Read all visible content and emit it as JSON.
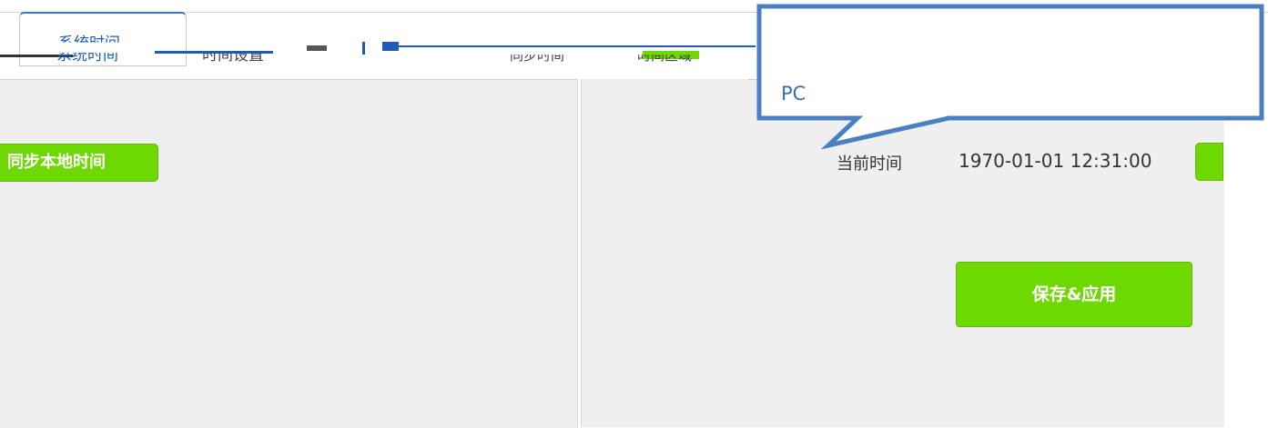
{
  "tabs": [
    {
      "label": "系统时间",
      "active": true
    },
    {
      "label": "时间设置",
      "active": false
    }
  ],
  "glitch_texts": [
    "时间设置",
    "同步时间",
    "时间区域"
  ],
  "left_panel": {
    "sync_button": "同步本地时间"
  },
  "right_panel": {
    "current_time_label": "当前时间",
    "current_time_value": "1970-01-01 12:31:00",
    "save_button": "保存&应用"
  },
  "tooltip": {
    "text": "PC"
  },
  "colors": {
    "accent_green": "#6ed802",
    "tab_blue": "#2f79d8",
    "tooltip_border": "#4a7fc1",
    "tooltip_text": "#3a6fb0",
    "panel_bg": "#efefef"
  }
}
